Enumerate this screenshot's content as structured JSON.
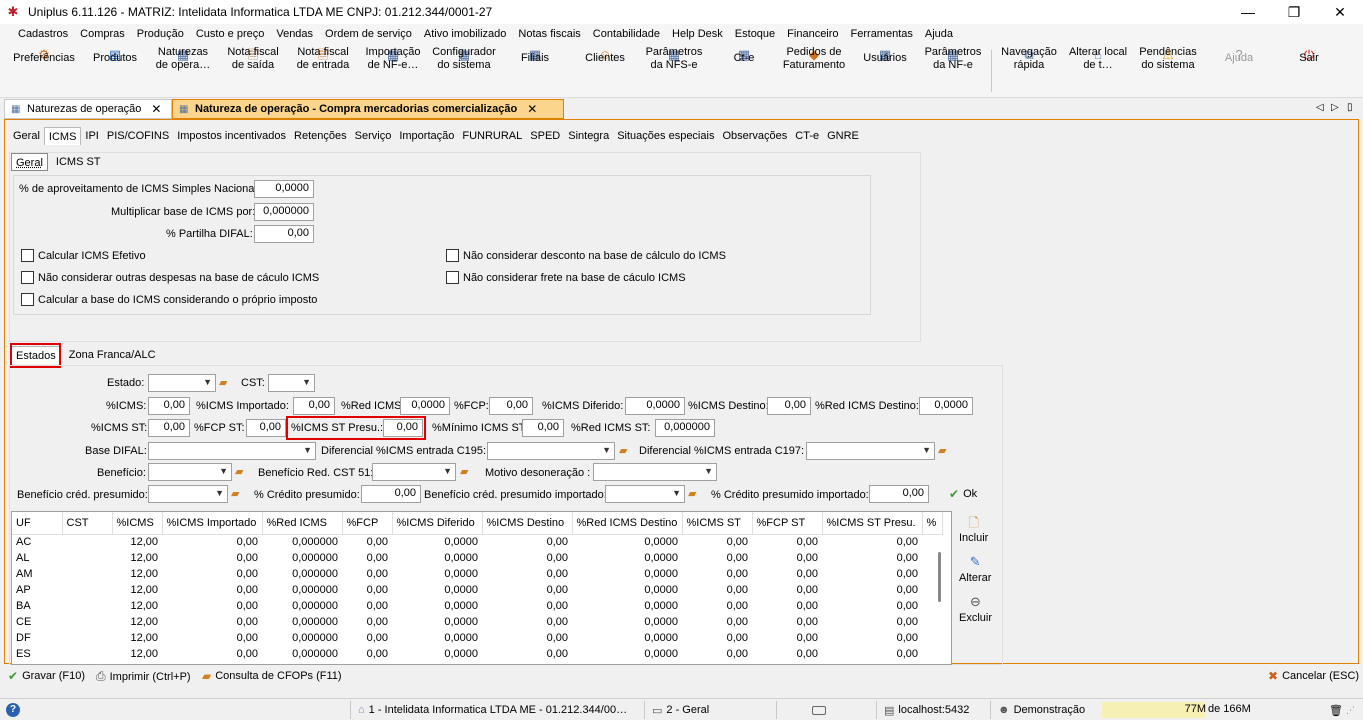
{
  "window": {
    "title": "Uniplus 6.11.126 - MATRIZ: Intelidata Informatica LTDA ME CNPJ: 01.212.344/0001-27",
    "controls": {
      "minimize": "—",
      "restore": "❐",
      "close": "✕"
    }
  },
  "menu": [
    "Cadastros",
    "Compras",
    "Produção",
    "Custo e preço",
    "Vendas",
    "Ordem de serviço",
    "Ativo imobilizado",
    "Notas fiscais",
    "Contabilidade",
    "Help Desk",
    "Estoque",
    "Financeiro",
    "Ferramentas",
    "Ajuda"
  ],
  "toolbar": [
    {
      "label": "Preferências",
      "icon": "preferences-icon"
    },
    {
      "label": "Produtos",
      "icon": "products-icon"
    },
    {
      "label": "Naturezas\nde opera…",
      "icon": "nature-icon"
    },
    {
      "label": "Nota fiscal\nde saída",
      "icon": "invoice-out-icon"
    },
    {
      "label": "Nota fiscal\nde entrada",
      "icon": "invoice-in-icon"
    },
    {
      "label": "Importação\nde NF-e…",
      "icon": "import-icon"
    },
    {
      "label": "Configurador\ndo sistema",
      "icon": "config-icon"
    },
    {
      "label": "Filiais",
      "icon": "branches-icon"
    },
    {
      "label": "Clientes",
      "icon": "clients-icon"
    },
    {
      "label": "Parâmetros\nda NFS-e",
      "icon": "nfse-icon"
    },
    {
      "label": "Ct-e",
      "icon": "cte-icon"
    },
    {
      "label": "Pedidos de\nFaturamento",
      "icon": "orders-icon"
    },
    {
      "label": "Usuários",
      "icon": "users-icon"
    },
    {
      "label": "Parâmetros\nda NF-e",
      "icon": "nfe-icon"
    },
    {
      "label": "Navegação\nrápida",
      "icon": "quick-nav-icon"
    },
    {
      "label": "Alterar local\nde t…",
      "icon": "home-icon"
    },
    {
      "label": "Pendências\ndo sistema",
      "icon": "warning-icon"
    },
    {
      "label": "Ajuda",
      "icon": "help-icon"
    },
    {
      "label": "Sair",
      "icon": "power-icon"
    }
  ],
  "doc_tabs": [
    {
      "label": "Naturezas de operação",
      "close": "✕"
    },
    {
      "label": "Natureza de operação - Compra mercadorias comercialização",
      "close": "✕"
    }
  ],
  "doc_tab_nav": {
    "prev": "◁",
    "next": "▷",
    "menu": "▯"
  },
  "main_tabs": [
    "Geral",
    "ICMS",
    "IPI",
    "PIS/COFINS",
    "Impostos incentivados",
    "Retenções",
    "Serviço",
    "Importação",
    "FUNRURAL",
    "SPED",
    "Sintegra",
    "Situações especiais",
    "Observações",
    "CT-e",
    "GNRE"
  ],
  "icms_tabs": [
    "Geral",
    "ICMS ST"
  ],
  "geral": {
    "aproveitamento_label": "% de aproveitamento de ICMS Simples Nacional:",
    "aproveitamento_value": "0,0000",
    "multiplicar_label": "Multiplicar base de ICMS por:",
    "multiplicar_value": "0,000000",
    "partilha_label": "% Partilha DIFAL:",
    "partilha_value": "0,00",
    "checks": [
      "Calcular ICMS Efetivo",
      "Não considerar outras despesas na base de cáculo ICMS",
      "Calcular a base do ICMS considerando o próprio imposto",
      "Não considerar desconto na base de cálculo do ICMS",
      "Não considerar frete na base de cáculo ICMS"
    ]
  },
  "estado_tabs": [
    "Estados",
    "Zona Franca/ALC"
  ],
  "form": {
    "estado": "Estado:",
    "cst": "CST:",
    "icms": "%ICMS:",
    "icms_v": "0,00",
    "icms_imp": "%ICMS Importado:",
    "icms_imp_v": "0,00",
    "red_icms": "%Red ICMS:",
    "red_icms_v": "0,0000",
    "fcp": "%FCP:",
    "fcp_v": "0,00",
    "icms_dif": "%ICMS Diferido:",
    "icms_dif_v": "0,0000",
    "icms_dest": "%ICMS Destino:",
    "icms_dest_v": "0,00",
    "red_icms_dest": "%Red ICMS Destino:",
    "red_icms_dest_v": "0,0000",
    "icms_st": "%ICMS ST:",
    "icms_st_v": "0,00",
    "fcp_st": "%FCP ST:",
    "fcp_st_v": "0,00",
    "icms_st_presu": "%ICMS ST Presu.:",
    "icms_st_presu_v": "0,00",
    "min_icms_st": "%Mínimo ICMS ST:",
    "min_icms_st_v": "0,00",
    "red_icms_st": "%Red ICMS ST:",
    "red_icms_st_v": "0,000000",
    "base_difal": "Base DIFAL:",
    "dif_195": "Diferencial %ICMS entrada C195:",
    "dif_197": "Diferencial %ICMS entrada C197:",
    "beneficio": "Benefício:",
    "beneficio_red": "Benefício Red. CST 51:",
    "motivo": "Motivo desoneração :",
    "bcp": "Benefício créd. presumido:",
    "credito_presumido": "% Crédito presumido:",
    "credito_presumido_v": "0,00",
    "bcp_imp": "Benefício créd. presumido importado:",
    "credito_presumido_imp": "% Crédito presumido importado:",
    "credito_presumido_imp_v": "0,00",
    "ok": "Ok"
  },
  "grid": {
    "columns": [
      "UF",
      "CST",
      "%ICMS",
      "%ICMS Importado",
      "%Red ICMS",
      "%FCP",
      "%ICMS Diferido",
      "%ICMS Destino",
      "%Red ICMS Destino",
      "%ICMS ST",
      "%FCP ST",
      "%ICMS ST Presu.",
      "%"
    ],
    "rows": [
      [
        "AC",
        "",
        "12,00",
        "0,00",
        "0,000000",
        "0,00",
        "0,0000",
        "0,00",
        "0,0000",
        "0,00",
        "0,00",
        "0,00"
      ],
      [
        "AL",
        "",
        "12,00",
        "0,00",
        "0,000000",
        "0,00",
        "0,0000",
        "0,00",
        "0,0000",
        "0,00",
        "0,00",
        "0,00"
      ],
      [
        "AM",
        "",
        "12,00",
        "0,00",
        "0,000000",
        "0,00",
        "0,0000",
        "0,00",
        "0,0000",
        "0,00",
        "0,00",
        "0,00"
      ],
      [
        "AP",
        "",
        "12,00",
        "0,00",
        "0,000000",
        "0,00",
        "0,0000",
        "0,00",
        "0,0000",
        "0,00",
        "0,00",
        "0,00"
      ],
      [
        "BA",
        "",
        "12,00",
        "0,00",
        "0,000000",
        "0,00",
        "0,0000",
        "0,00",
        "0,0000",
        "0,00",
        "0,00",
        "0,00"
      ],
      [
        "CE",
        "",
        "12,00",
        "0,00",
        "0,000000",
        "0,00",
        "0,0000",
        "0,00",
        "0,0000",
        "0,00",
        "0,00",
        "0,00"
      ],
      [
        "DF",
        "",
        "12,00",
        "0,00",
        "0,000000",
        "0,00",
        "0,0000",
        "0,00",
        "0,0000",
        "0,00",
        "0,00",
        "0,00"
      ],
      [
        "ES",
        "",
        "12,00",
        "0,00",
        "0,000000",
        "0,00",
        "0,0000",
        "0,00",
        "0,0000",
        "0,00",
        "0,00",
        "0,00"
      ]
    ]
  },
  "side_buttons": {
    "incluir": "Incluir",
    "alterar": "Alterar",
    "excluir": "Excluir"
  },
  "bottom": {
    "gravar": "Gravar (F10)",
    "imprimir": "Imprimir (Ctrl+P)",
    "consulta": "Consulta de CFOPs (F11)",
    "cancelar": "Cancelar (ESC)"
  },
  "status": {
    "company": "1 - Intelidata Informatica LTDA ME - 01.212.344/00…",
    "module": "2 - Geral",
    "server": "localhost:5432",
    "user": "Demonstração",
    "memory_used": "77M",
    "memory_total": "de 166M",
    "memory_fraction": 0.46
  },
  "colors": {
    "accent_border": "#e08000",
    "active_tab": "#fbd58c",
    "highlight": "#e00000",
    "memory_bar": "#f6f0b4"
  }
}
